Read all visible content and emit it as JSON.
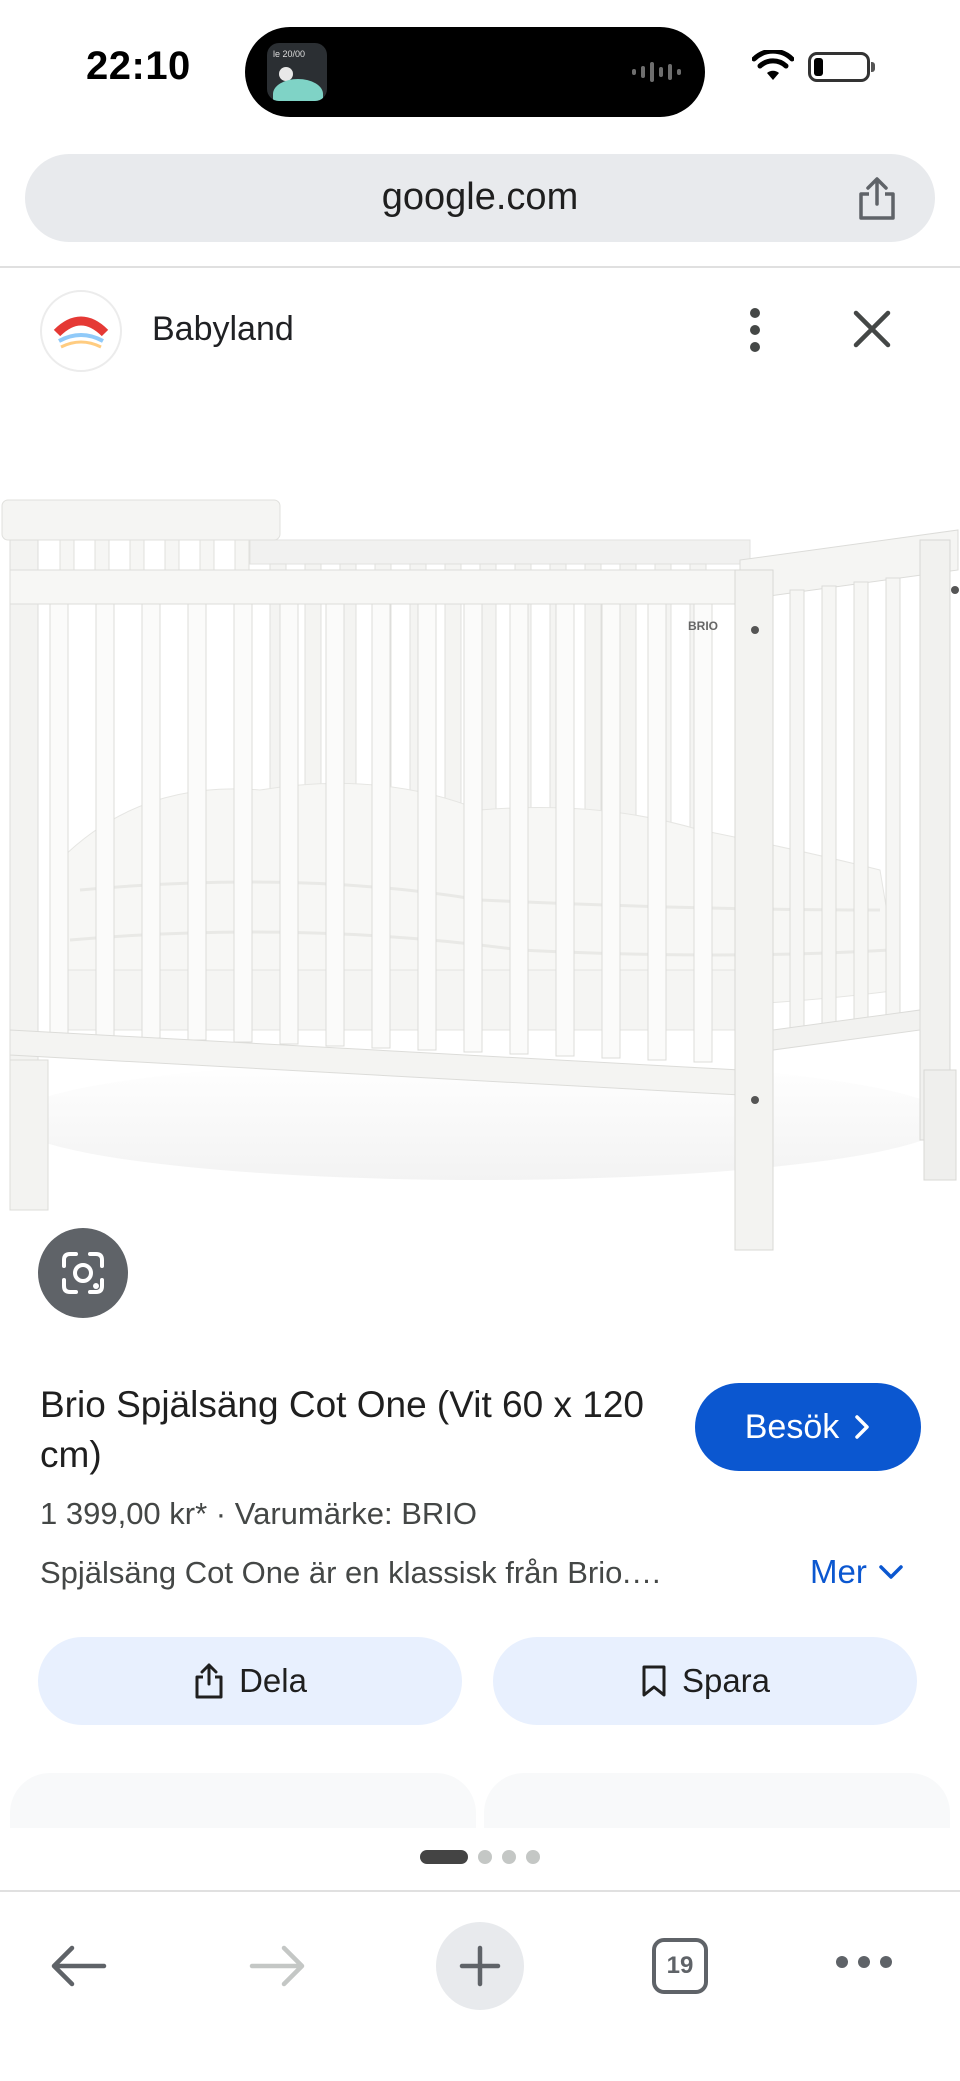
{
  "status_bar": {
    "time": "22:10",
    "island_thumb_text": "le 20/00"
  },
  "browser": {
    "url": "google.com"
  },
  "source": {
    "name": "Babyland",
    "logo_text": "BABYLAND"
  },
  "product": {
    "title": "Brio Spjälsäng Cot One (Vit 60 x 120 cm)",
    "price_line": "1 399,00 kr* · Varumärke: BRIO",
    "description": "Spjälsäng Cot One är en klassisk från Brio.…",
    "more_label": "Mer",
    "visit_label": "Besök",
    "image_brand_label": "BRIO"
  },
  "actions": {
    "share_label": "Dela",
    "save_label": "Spara"
  },
  "toolbar": {
    "tab_count": "19"
  },
  "carousel": {
    "page_count": 4,
    "active_page": 1
  },
  "colors": {
    "accent": "#0b57d0",
    "chip_bg": "#e8f0fe",
    "url_bar_bg": "#e8eaed"
  },
  "icons": [
    "wifi-icon",
    "battery-icon",
    "share-icon",
    "more-vert-icon",
    "close-icon",
    "lens-icon",
    "chevron-right-icon",
    "chevron-down-icon",
    "bookmark-icon",
    "back-arrow-icon",
    "forward-arrow-icon",
    "plus-icon",
    "tabs-icon",
    "more-horiz-icon"
  ]
}
